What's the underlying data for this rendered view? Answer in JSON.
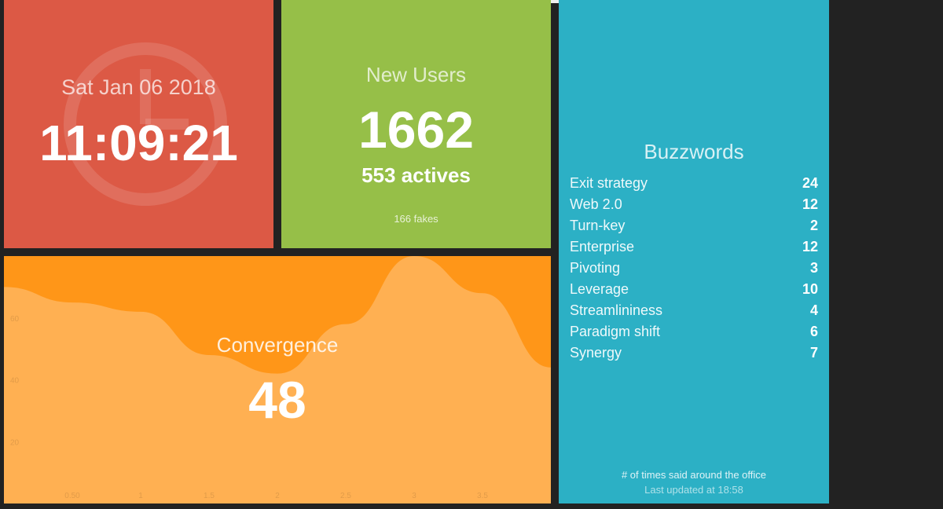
{
  "clock": {
    "date": "Sat Jan 06 2018",
    "time": "11:09:21"
  },
  "new_users": {
    "title": "New Users",
    "value": "1662",
    "actives": "553 actives",
    "fakes": "166 fakes"
  },
  "convergence": {
    "title": "Convergence",
    "value": "48"
  },
  "buzzwords": {
    "title": "Buzzwords",
    "items": [
      {
        "label": "Exit strategy",
        "value": "24"
      },
      {
        "label": "Web 2.0",
        "value": "12"
      },
      {
        "label": "Turn-key",
        "value": "2"
      },
      {
        "label": "Enterprise",
        "value": "12"
      },
      {
        "label": "Pivoting",
        "value": "3"
      },
      {
        "label": "Leverage",
        "value": "10"
      },
      {
        "label": "Streamlininess",
        "value": "4"
      },
      {
        "label": "Paradigm shift",
        "value": "6"
      },
      {
        "label": "Synergy",
        "value": "7"
      }
    ],
    "more_info": "# of times said around the office",
    "updated_at": "Last updated at 18:58"
  },
  "colors": {
    "clock_bg": "#dc5945",
    "users_bg": "#96bf48",
    "convergence_bg": "#ff9618",
    "buzz_bg": "#2cb0c5",
    "page_bg": "#222222"
  },
  "chart_data": {
    "type": "area",
    "x": [
      0,
      0.5,
      1,
      1.5,
      2,
      2.5,
      3,
      3.5,
      4
    ],
    "series": [
      {
        "values": [
          70,
          65,
          62,
          48,
          42,
          58,
          80,
          68,
          44
        ]
      }
    ],
    "x_ticks": [
      "0.50",
      "1",
      "1.5",
      "2",
      "2.5",
      "3",
      "3.5"
    ],
    "y_ticks": [
      "20",
      "40",
      "60"
    ],
    "xlim": [
      0,
      4
    ],
    "ylim": [
      0,
      80
    ]
  }
}
